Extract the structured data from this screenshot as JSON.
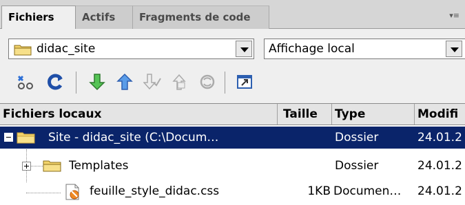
{
  "tabs": [
    {
      "label": "Fichiers",
      "active": true
    },
    {
      "label": "Actifs",
      "active": false
    },
    {
      "label": "Fragments de code",
      "active": false
    }
  ],
  "site_select": {
    "value": "didac_site",
    "icon": "folder-icon"
  },
  "view_select": {
    "value": "Affichage local"
  },
  "toolbar": {
    "icons": [
      "connect-icon",
      "refresh-icon",
      "get-down-arrow-icon",
      "put-up-arrow-icon",
      "check-out-icon",
      "check-in-icon",
      "synchronize-icon",
      "expand-panel-icon"
    ]
  },
  "columns": {
    "name": "Fichiers locaux",
    "size": "Taille",
    "type": "Type",
    "modified": "Modifi"
  },
  "rows": [
    {
      "name": "Site - didac_site (C:\\Docum…",
      "size": "",
      "type": "Dossier",
      "modified": "24.01.2",
      "icon": "folder-icon",
      "selected": true
    },
    {
      "name": "Templates",
      "size": "",
      "type": "Dossier",
      "modified": "24.01.2",
      "icon": "folder-icon",
      "selected": false
    },
    {
      "name": "feuille_style_didac.css",
      "size": "1KB",
      "type": "Documen…",
      "modified": "24.01.2",
      "icon": "css-file-icon",
      "selected": false
    }
  ],
  "colors": {
    "selection": "#0a246a",
    "folder": "#f2d36b",
    "green_arrow": "#2f9e2f",
    "blue_arrow": "#2d6fd6"
  }
}
